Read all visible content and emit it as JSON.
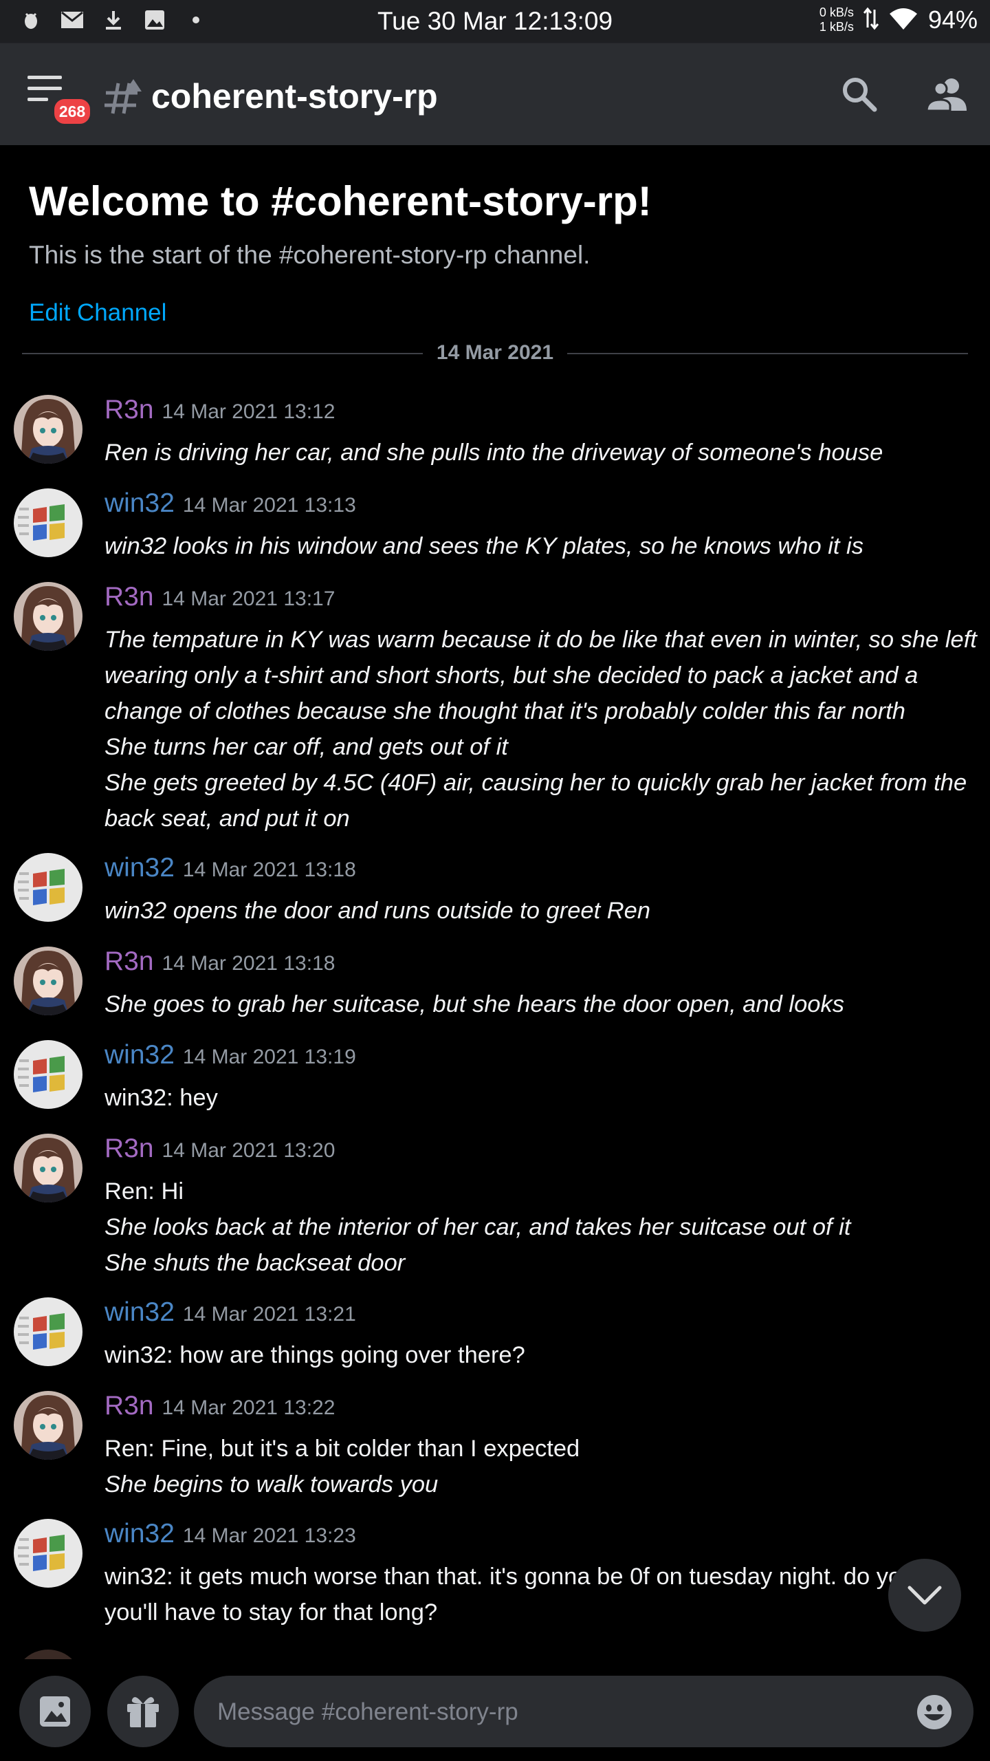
{
  "status_bar": {
    "time": "Tue 30 Mar 12:13:09",
    "net_down": "0 kB/s",
    "net_up": "1 kB/s",
    "battery": "94%"
  },
  "header": {
    "channel_name": "coherent-story-rp",
    "notification_count": "268"
  },
  "welcome": {
    "title": "Welcome to #coherent-story-rp!",
    "subtitle": "This is the start of the #coherent-story-rp channel.",
    "edit_channel": "Edit Channel",
    "date_divider": "14 Mar 2021"
  },
  "messages": [
    {
      "author": "R3n",
      "timestamp": "14 Mar 2021 13:12",
      "lines": [
        "Ren is driving her car, and she pulls into the driveway of someone's house"
      ]
    },
    {
      "author": "win32",
      "timestamp": "14 Mar 2021 13:13",
      "lines": [
        "win32 looks in his window and sees the KY plates, so he knows who it is"
      ]
    },
    {
      "author": "R3n",
      "timestamp": "14 Mar 2021 13:17",
      "lines": [
        "The tempature in KY was warm because it do be like that even in winter, so she left",
        "wearing only a t-shirt and short shorts, but she decided to pack a jacket and a",
        "change of clothes because she thought that it's probably colder this far north",
        "She turns her car off, and gets out of it",
        "She gets greeted by 4.5C (40F) air, causing her to quickly grab her jacket from the",
        "back seat, and put it on"
      ]
    },
    {
      "author": "win32",
      "timestamp": "14 Mar 2021 13:18",
      "lines": [
        "win32 opens the door and runs outside to greet Ren"
      ]
    },
    {
      "author": "R3n",
      "timestamp": "14 Mar 2021 13:18",
      "lines": [
        "She goes to grab her suitcase, but she hears the door open, and looks"
      ]
    },
    {
      "author": "win32",
      "timestamp": "14 Mar 2021 13:19",
      "lines": [
        "win32: hey"
      ]
    },
    {
      "author": "R3n",
      "timestamp": "14 Mar 2021 13:20",
      "lines": [
        "Ren: Hi",
        "She looks back at the interior of her car, and takes her suitcase out of it",
        "She shuts the backseat door"
      ]
    },
    {
      "author": "win32",
      "timestamp": "14 Mar 2021 13:21",
      "lines": [
        "win32: how are things going over there?"
      ]
    },
    {
      "author": "R3n",
      "timestamp": "14 Mar 2021 13:22",
      "lines": [
        "Ren: Fine, but it's a bit colder than I expected",
        "She begins to walk towards you"
      ]
    },
    {
      "author": "win32",
      "timestamp": "14 Mar 2021 13:23",
      "lines": [
        "win32: it gets much worse than that. it's gonna be 0f on tuesday night. do yo",
        "you'll have to stay for that long?"
      ]
    }
  ],
  "composer": {
    "placeholder": "Message #coherent-story-rp"
  },
  "colors": {
    "background": "#000000",
    "header": "#2b2d31",
    "r3n_name": "#a36ac2",
    "win32_name": "#4a86c5",
    "link": "#00a8fc",
    "badge": "#ed4245"
  }
}
